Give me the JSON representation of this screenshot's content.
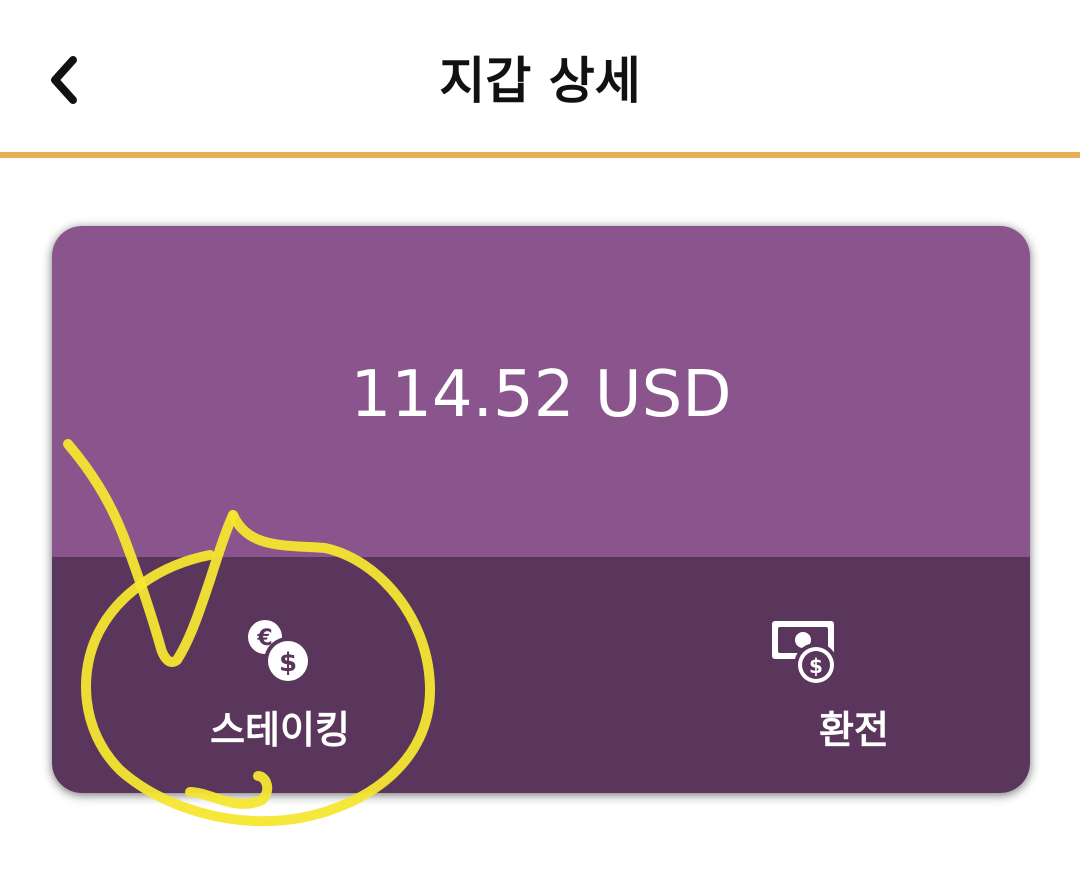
{
  "header": {
    "title": "지갑 상세",
    "back_icon": "chevron-left-icon"
  },
  "wallet": {
    "balance": "114.52 USD",
    "actions": [
      {
        "label": "스테이킹",
        "icon": "coins-euro-dollar-icon"
      },
      {
        "label": "환전",
        "icon": "cash-exchange-icon"
      }
    ]
  },
  "colors": {
    "accent_divider": "#e8ae55",
    "card_top": "#8a548d",
    "card_bottom": "#5b365c",
    "annotation": "#f5e630"
  }
}
